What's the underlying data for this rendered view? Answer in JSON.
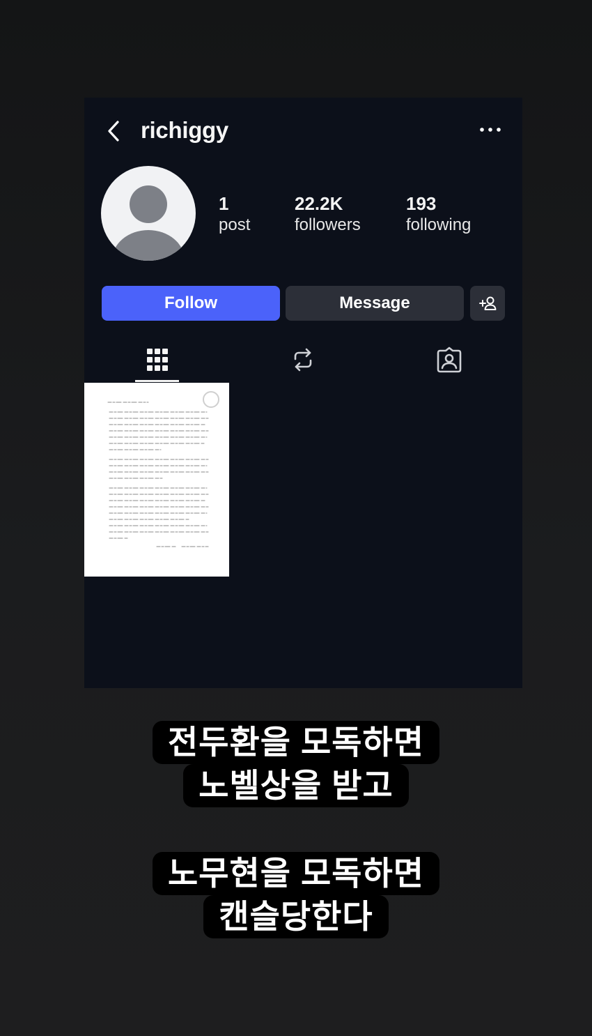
{
  "profile": {
    "username": "richiggy",
    "stats": [
      {
        "value": "1",
        "label": "post"
      },
      {
        "value": "22.2K",
        "label": "followers"
      },
      {
        "value": "193",
        "label": "following"
      }
    ]
  },
  "actions": {
    "follow_label": "Follow",
    "message_label": "Message"
  },
  "tabs": [
    {
      "icon": "grid-icon",
      "active": true
    },
    {
      "icon": "repost-icon",
      "active": false
    },
    {
      "icon": "tagged-icon",
      "active": false
    }
  ],
  "captions": [
    {
      "line1": "전두환을 모독하면",
      "line2": "노벨상을 받고"
    },
    {
      "line1": "노무현을 모독하면",
      "line2": "캔슬당한다"
    }
  ],
  "colors": {
    "follow_button": "#4b62fa",
    "card_background": "#0c101a",
    "secondary_button": "#2c2f38"
  }
}
